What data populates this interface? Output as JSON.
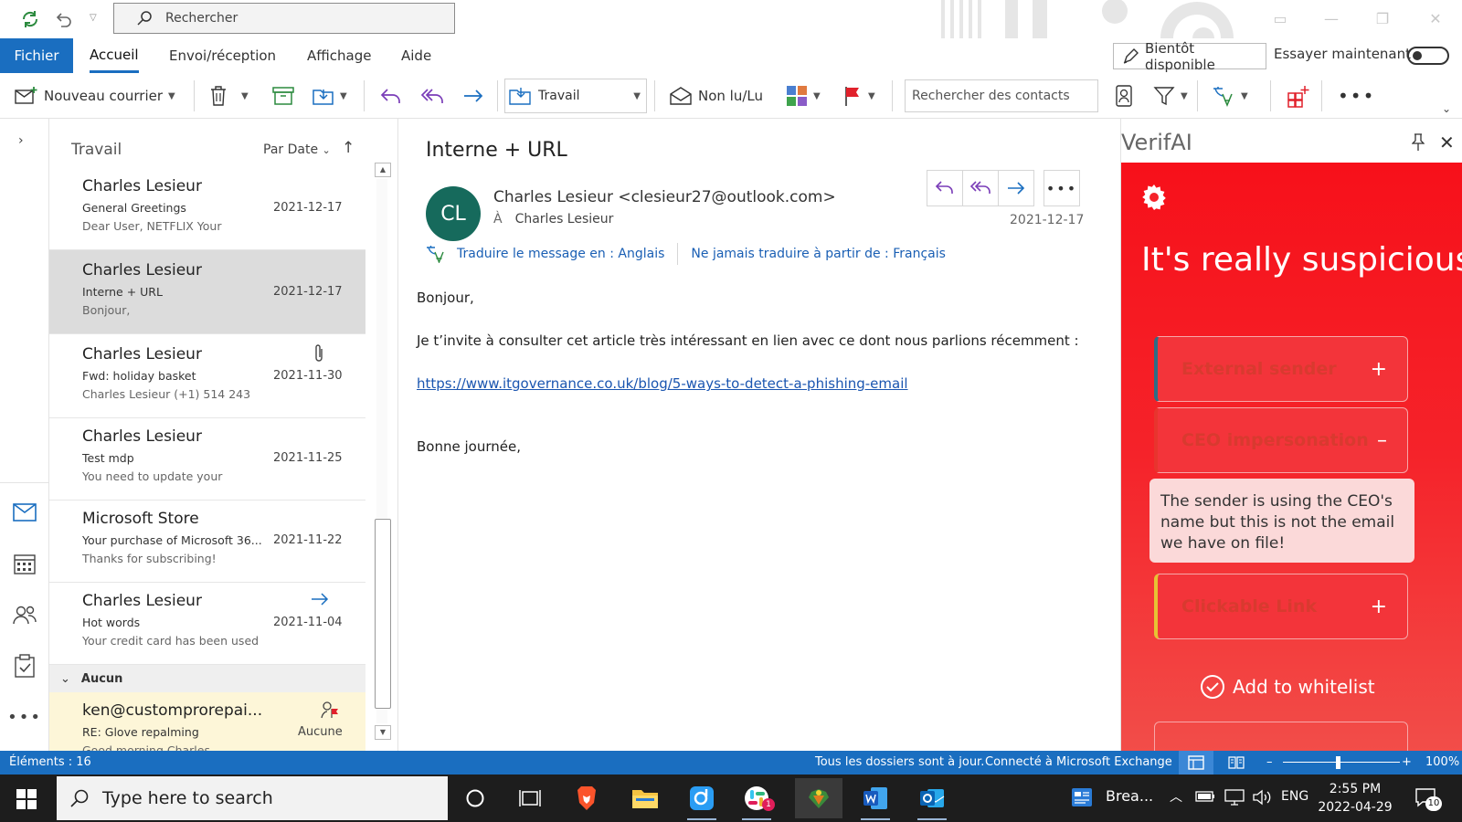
{
  "title_bar": {
    "search_placeholder": "Rechercher"
  },
  "ribbon": {
    "tabs": [
      "Fichier",
      "Accueil",
      "Envoi/réception",
      "Affichage",
      "Aide"
    ],
    "active_tab": "Accueil",
    "soon_button": "Bientôt disponible",
    "try_now_label": "Essayer maintenant"
  },
  "toolbar": {
    "new_mail": "Nouveau courrier",
    "folder": "Travail",
    "read_unread": "Non lu/Lu",
    "contact_search_placeholder": "Rechercher des contacts"
  },
  "message_list": {
    "folder_title": "Travail",
    "sort_label": "Par Date",
    "messages": [
      {
        "from": "Charles Lesieur",
        "subject": "General Greetings",
        "preview": "Dear User,   NETFLIX Your",
        "date": "2021-12-17"
      },
      {
        "from": "Charles Lesieur",
        "subject": "Interne + URL",
        "preview": "Bonjour,",
        "date": "2021-12-17"
      },
      {
        "from": "Charles Lesieur",
        "subject": "Fwd: holiday basket",
        "preview": "Charles Lesieur  (+1) 514 243",
        "date": "2021-11-30"
      },
      {
        "from": "Charles Lesieur",
        "subject": "Test mdp",
        "preview": "You need to update your",
        "date": "2021-11-25"
      },
      {
        "from": "Microsoft Store",
        "subject": "Your purchase of Microsoft 36...",
        "preview": "Thanks for subscribing!",
        "date": "2021-11-22"
      },
      {
        "from": "Charles Lesieur",
        "subject": "Hot words",
        "preview": "Your credit card has been used",
        "date": "2021-11-04"
      }
    ],
    "group_label": "Aucun",
    "grouped_message": {
      "from": "ken@customprorepai...",
      "subject": "RE: Glove repalming",
      "preview": "Good morning Charles",
      "category": "Aucune"
    }
  },
  "reading_pane": {
    "subject": "Interne + URL",
    "avatar_initials": "CL",
    "sender": "Charles Lesieur <clesieur27@outlook.com>",
    "to_prefix": "À",
    "to": "Charles Lesieur",
    "date": "2021-12-17",
    "translate_link": "Traduire le message en : Anglais",
    "never_translate_link": "Ne jamais traduire à partir de : Français",
    "body": {
      "greeting": "Bonjour,",
      "paragraph": "Je t’invite à consulter cet article très intéressant en lien avec ce dont nous parlions récemment :",
      "link": "https://www.itgovernance.co.uk/blog/5-ways-to-detect-a-phishing-email",
      "closing": "Bonne journée,"
    }
  },
  "verifai": {
    "title": "VerifAI",
    "verdict": "It's really suspicious",
    "rules": [
      {
        "label": "External sender",
        "sign": "+"
      },
      {
        "label": "CEO impersonation",
        "sign": "–"
      },
      {
        "label": "Clickable Link",
        "sign": "+"
      }
    ],
    "ceo_detail": "The sender is using the CEO's name but this is not the email we have on file!",
    "whitelist": "Add to whitelist"
  },
  "status_bar": {
    "items_count": "Éléments : 16",
    "sync_status": "Tous les dossiers sont à jour.",
    "connection": "Connecté à Microsoft Exchange",
    "zoom": "100%"
  },
  "taskbar": {
    "search_placeholder": "Type here to search",
    "widget_label": "Brea...",
    "language": "ENG",
    "time": "2:55 PM",
    "date": "2022-04-29",
    "slack_badge": "1",
    "notification_count": "10"
  },
  "colors": {
    "accent": "#1a6ec0",
    "verifai_red": "#f5232a",
    "avatar": "#166a5c"
  }
}
